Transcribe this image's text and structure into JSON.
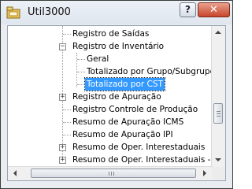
{
  "window": {
    "title": "Util3000",
    "help_label": "?",
    "close_label": "✕"
  },
  "icons": {
    "app": "app-icon",
    "expand": "plus",
    "collapse": "minus"
  },
  "tree": {
    "items": [
      {
        "label": "Registro de Saídas",
        "expander": ""
      },
      {
        "label": "Registro de Inventário",
        "expander": "−"
      },
      {
        "label": "Geral",
        "expander": ""
      },
      {
        "label": "Totalizado por Grupo/Subgrupo",
        "expander": ""
      },
      {
        "label": "Totalizado por CST",
        "expander": ""
      },
      {
        "label": "Registro de Apuração",
        "expander": "+"
      },
      {
        "label": "Registro Controle de Produção",
        "expander": ""
      },
      {
        "label": "Resumo de Apuração ICMS",
        "expander": ""
      },
      {
        "label": "Resumo de Apuração IPI",
        "expander": ""
      },
      {
        "label": "Resumo de Oper. Interestaduais",
        "expander": "+"
      },
      {
        "label": "Resumo de Oper. Interestaduais - GIM",
        "expander": "+"
      }
    ],
    "selected": "Totalizado por CST"
  }
}
